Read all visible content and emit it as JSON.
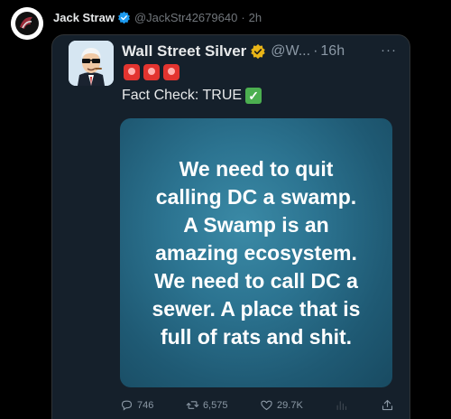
{
  "outer_tweet": {
    "author_name": "Jack Straw",
    "author_handle": "@JackStr42679640",
    "separator": "·",
    "time": "2h"
  },
  "quoted_tweet": {
    "author_name": "Wall Street Silver",
    "author_handle": "@W...",
    "separator": "·",
    "time": "16h",
    "more": "···",
    "siren_icons": [
      "rotating-light",
      "rotating-light",
      "rotating-light"
    ],
    "fact_check_text": "Fact Check: TRUE",
    "meme_lines": [
      "We need to quit",
      "calling DC a swamp.",
      "A Swamp is an",
      "amazing ecosystem.",
      "We need to call DC a",
      "sewer. A place that is",
      "full of rats and shit."
    ]
  },
  "actions": {
    "replies": "746",
    "retweets": "6,575",
    "likes": "29.7K"
  },
  "colors": {
    "background": "#000000",
    "card": "#15202b",
    "verified_blue": "#1d9bf0",
    "verified_gold": "#e8b417",
    "muted_text": "#71767b"
  }
}
